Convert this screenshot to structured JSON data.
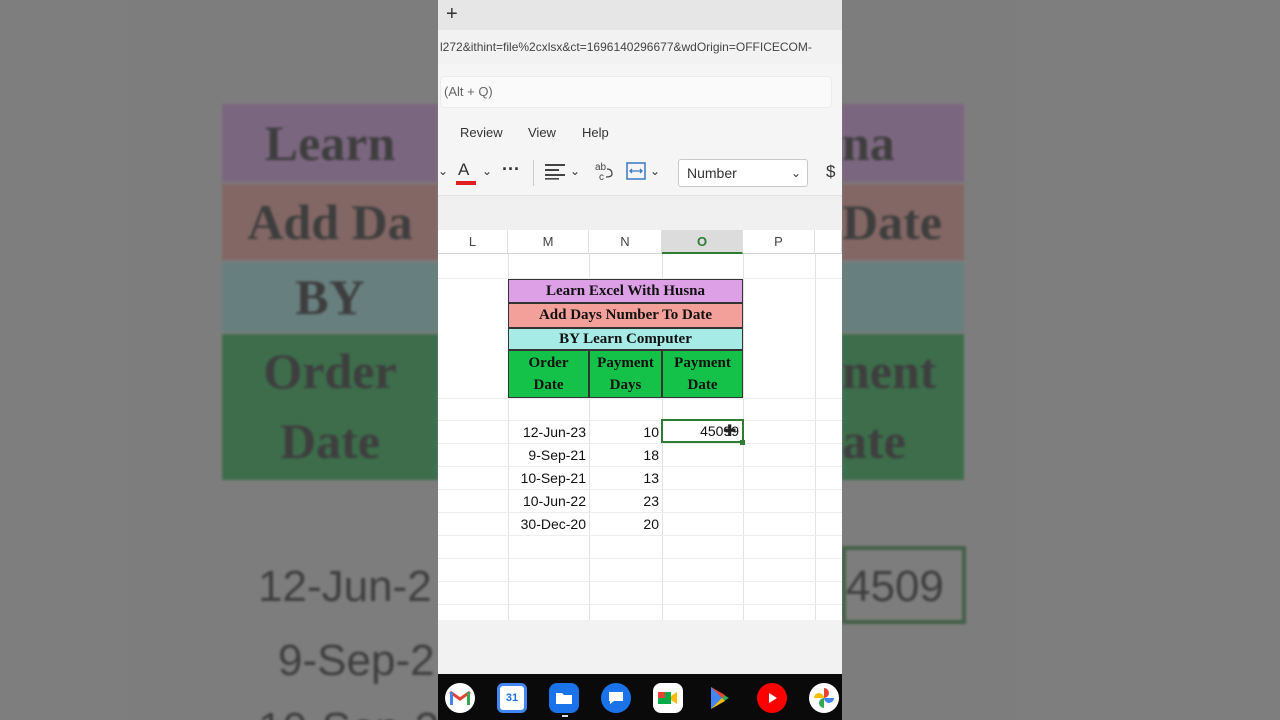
{
  "browser": {
    "new_tab": "+",
    "url": "l272&ithint=file%2cxlsx&ct=1696140296677&wdOrigin=OFFICECOM-"
  },
  "search": {
    "placeholder": "(Alt + Q)"
  },
  "menu": {
    "items": [
      "Review",
      "View",
      "Help"
    ]
  },
  "toolbar": {
    "font_color_label": "A",
    "more_label": "···",
    "number_format": "Number",
    "currency_label": "$",
    "font_color_hex": "#e02020"
  },
  "sheet": {
    "columns": [
      "L",
      "M",
      "N",
      "O",
      "P"
    ],
    "selected_column": "O",
    "title_rows": [
      "Learn Excel With Husna",
      "Add Days Number To Date",
      "BY Learn  Computer"
    ],
    "headers": [
      [
        "Order",
        "Date"
      ],
      [
        "Payment",
        "Days"
      ],
      [
        "Payment",
        "Date"
      ]
    ],
    "rows": [
      {
        "order_date": "12-Jun-23",
        "payment_days": "10",
        "payment_date": "45099"
      },
      {
        "order_date": "9-Sep-21",
        "payment_days": "18",
        "payment_date": ""
      },
      {
        "order_date": "10-Sep-21",
        "payment_days": "13",
        "payment_date": ""
      },
      {
        "order_date": "10-Jun-22",
        "payment_days": "23",
        "payment_date": ""
      },
      {
        "order_date": "30-Dec-20",
        "payment_days": "20",
        "payment_date": ""
      }
    ],
    "colors": {
      "title1": "#dda0e6",
      "title2": "#f4a09a",
      "title3": "#a6ebe6",
      "header": "#14c24a",
      "selection": "#2e7d32"
    }
  },
  "background": {
    "left_cells": [
      "Learn",
      "Add Da",
      "BY",
      "Order",
      "Date"
    ],
    "right_cells": [
      "na",
      "Date",
      "nent",
      "ate"
    ],
    "left_values": [
      "12-Jun-2",
      "9-Sep-2",
      "10-Sep-2"
    ],
    "right_value": "4509"
  },
  "dock": {
    "apps": [
      "gmail-icon",
      "calendar-icon",
      "files-icon",
      "messages-icon",
      "meet-icon",
      "play-store-icon",
      "youtube-icon",
      "photos-icon"
    ],
    "calendar_day": "31"
  }
}
